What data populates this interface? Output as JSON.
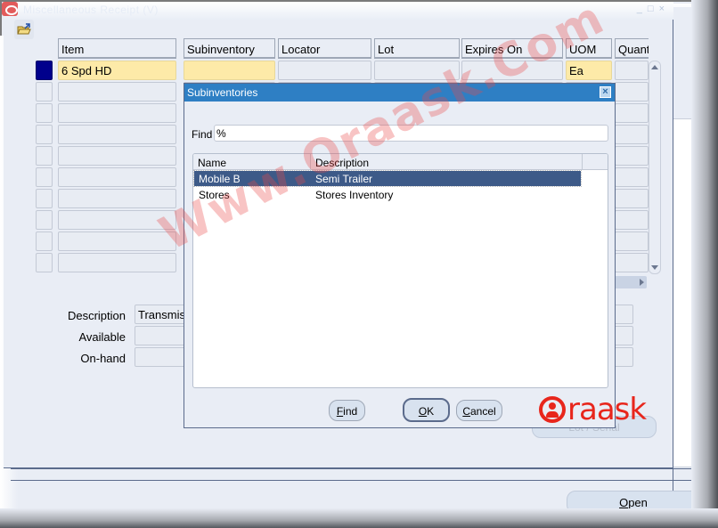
{
  "window": {
    "title": "Miscellaneous Receipt (V)",
    "controls": {
      "minimize": "_",
      "maximize": "□",
      "close": "×"
    }
  },
  "grid": {
    "columns": [
      "Item",
      "Subinventory",
      "Locator",
      "Lot",
      "Expires On",
      "UOM",
      "Quant"
    ],
    "rows": [
      {
        "item": "6 Spd HD",
        "subinventory": "",
        "locator": "",
        "lot": "",
        "expires_on": "",
        "uom": "Ea",
        "quantity": ""
      }
    ],
    "empty_rows": 9
  },
  "details": {
    "description_label": "Description",
    "description_value": "Transmis",
    "available_label": "Available",
    "available_value": "",
    "onhand_label": "On-hand",
    "onhand_value": ""
  },
  "background_button": {
    "label": "Lot / Serial"
  },
  "open_button": {
    "label_prefix": "",
    "mnemonic": "O",
    "label_rest": "pen"
  },
  "dialog": {
    "title": "Subinventories",
    "find_label": "Find",
    "find_value": "%",
    "list_columns": [
      "Name",
      "Description"
    ],
    "list_rows": [
      {
        "name": "Mobile B",
        "description": "Semi Trailer",
        "selected": true
      },
      {
        "name": "Stores",
        "description": "Stores Inventory",
        "selected": false
      }
    ],
    "buttons": {
      "find": {
        "mnemonic": "F",
        "rest": "ind"
      },
      "ok": {
        "mnemonic": "O",
        "rest": "K"
      },
      "cancel": {
        "mnemonic": "C",
        "rest": "ancel"
      }
    },
    "close_icon": "×"
  },
  "watermark": {
    "diagonal_text": "Www.Oraask.Com",
    "logo_text": "raask"
  },
  "colors": {
    "dialog_title_bg": "#2e7fc4",
    "selected_row_bg": "#3d5a88",
    "active_row_marker": "#00008c",
    "required_field": "#fdeaa8",
    "watermark_red": "#e8261c"
  }
}
